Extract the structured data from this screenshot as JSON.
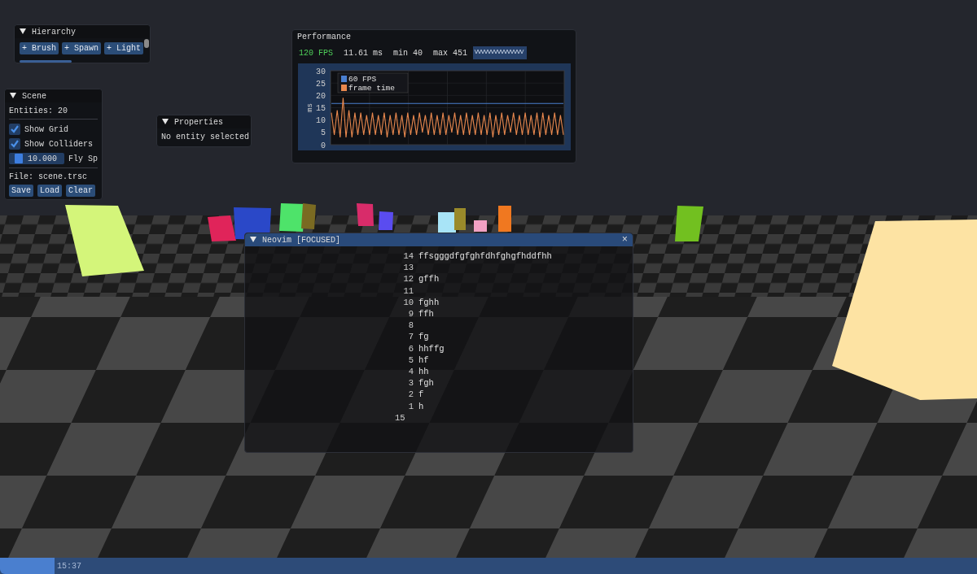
{
  "hierarchy": {
    "title": "Hierarchy",
    "expanded": true,
    "buttons": [
      "+ Brush",
      "+ Spawn",
      "+ Light"
    ]
  },
  "scene": {
    "title": "Scene",
    "expanded": true,
    "entities": "Entities: 20",
    "toggles": [
      {
        "label": "Show Grid",
        "checked": true
      },
      {
        "label": "Show Colliders",
        "checked": true
      }
    ],
    "slider": {
      "value": "10.000",
      "level": 0.12,
      "label": "Fly Sp"
    },
    "file": "File: scene.trsc",
    "buttons": [
      "Save",
      "Load",
      "Clear"
    ]
  },
  "properties": {
    "title": "Properties",
    "expanded": true,
    "message": "No entity selected"
  },
  "performance": {
    "title": "Performance",
    "fps": "120 FPS",
    "frame_ms": "11.61 ms",
    "min": "min 40",
    "max": "max 451",
    "chart_data": {
      "type": "line",
      "grid": true,
      "legend": true,
      "ylabel": "ms",
      "ylim": [
        0,
        30
      ],
      "yticks": [
        0,
        5,
        10,
        15,
        20,
        25,
        30
      ],
      "series": [
        {
          "name": "60 FPS",
          "color": "#4a7fcf",
          "values": [
            16.7,
            16.7,
            16.7,
            16.7,
            16.7,
            16.7,
            16.7,
            16.7,
            16.7,
            16.7,
            16.7,
            16.7,
            16.7,
            16.7,
            16.7,
            16.7,
            16.7,
            16.7,
            16.7,
            16.7,
            16.7,
            16.7,
            16.7,
            16.7,
            16.7,
            16.7,
            16.7,
            16.7,
            16.7,
            16.7,
            16.7,
            16.7,
            16.7,
            16.7,
            16.7,
            16.7,
            16.7,
            16.7,
            16.7,
            16.7,
            16.7,
            16.7,
            16.7,
            16.7,
            16.7,
            16.7,
            16.7,
            16.7,
            16.7,
            16.7,
            16.7,
            16.7,
            16.7,
            16.7,
            16.7,
            16.7,
            16.7,
            16.7,
            16.7,
            16.7,
            16.7,
            16.7,
            16.7,
            16.7,
            16.7,
            16.7,
            16.7,
            16.7,
            16.7,
            16.7,
            16.7,
            16.7,
            16.7,
            16.7,
            16.7,
            16.7,
            16.7,
            16.7,
            16.7,
            16.7
          ]
        },
        {
          "name": "frame time",
          "color": "#e8884e",
          "values": [
            13,
            4,
            14,
            3,
            19,
            3,
            14,
            3,
            13,
            4,
            13,
            4,
            12,
            4,
            13,
            4,
            12,
            4,
            13,
            3,
            12,
            4,
            13,
            4,
            12,
            3,
            13,
            4,
            12,
            4,
            13,
            5,
            12,
            4,
            13,
            4,
            12,
            4,
            13,
            4,
            12,
            5,
            13,
            4,
            12,
            4,
            13,
            4,
            12,
            4,
            13,
            4,
            12,
            4,
            13,
            3,
            12,
            4,
            13,
            4,
            12,
            5,
            13,
            4,
            12,
            4,
            13,
            4,
            12,
            4,
            13,
            3,
            13,
            4,
            12,
            4,
            13,
            4,
            12,
            4
          ]
        }
      ]
    }
  },
  "editor": {
    "title": "Neovim [FOCUSED]",
    "close": "×",
    "expanded": true,
    "lines": [
      {
        "number": "14",
        "text": "ffsgggdfgfghfdhfghgfhddfhh",
        "current": false
      },
      {
        "number": "13",
        "current": false
      },
      {
        "number": "12",
        "text": "gffh",
        "current": false
      },
      {
        "number": "11",
        "current": false
      },
      {
        "number": "10",
        "text": "fghh",
        "current": false
      },
      {
        "number": "9",
        "text": "ffh",
        "current": false
      },
      {
        "number": "8",
        "current": false
      },
      {
        "number": "7",
        "text": "fg",
        "current": false
      },
      {
        "number": "6",
        "text": "hhffg",
        "current": false
      },
      {
        "number": "5",
        "text": "hf",
        "current": false
      },
      {
        "number": "4",
        "text": "hh",
        "current": false
      },
      {
        "number": "3",
        "text": "fgh",
        "current": false
      },
      {
        "number": "2",
        "text": "f",
        "current": false
      },
      {
        "number": "1",
        "text": "h",
        "current": false
      },
      {
        "number": "15",
        "current": true
      }
    ]
  },
  "status_bar": {
    "level": 0.056,
    "time": "15:37"
  }
}
